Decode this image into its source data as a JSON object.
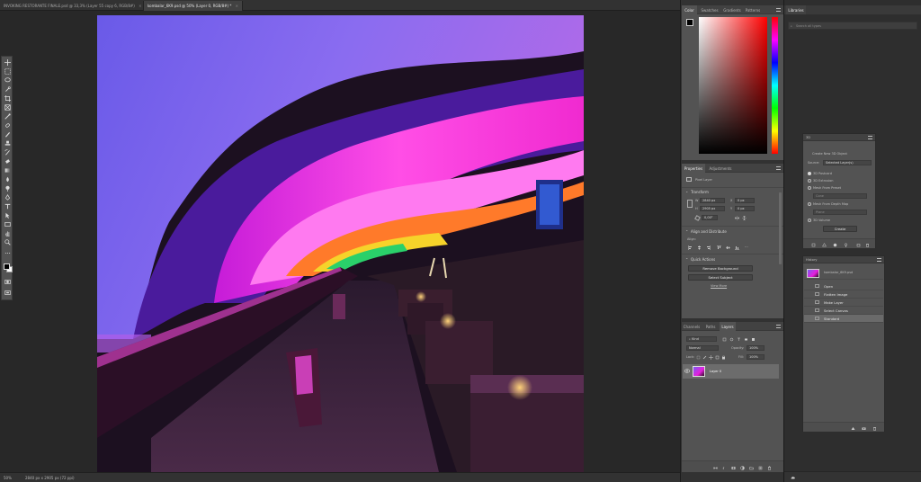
{
  "document_tabs": [
    {
      "label": "INVOKING RESTORANTE FINALE.psd @ 33,3% (Layer 55 copy 6, RGB/8#)",
      "close": "×"
    },
    {
      "label": "kombalar_6K9.psd @ 50% (Layer 0, RGB/8#) *",
      "close": "×"
    }
  ],
  "status": {
    "zoom": "50%",
    "doc_info": "2840 px x 2905 px (72 ppi)"
  },
  "color_panel": {
    "tabs": [
      "Color",
      "Swatches",
      "Gradients",
      "Patterns"
    ]
  },
  "properties_panel": {
    "tabs": [
      "Properties",
      "Adjustments"
    ],
    "layer_kind": "Pixel Layer",
    "transform": {
      "title": "Transform",
      "w_label": "W",
      "w_value": "2840 px",
      "h_label": "H",
      "h_value": "2905 px",
      "x_label": "X",
      "x_value": "0 px",
      "y_label": "Y",
      "y_value": "0 px",
      "angle": "0,00°"
    },
    "align": {
      "title": "Align and Distribute",
      "align_label": "Align:",
      "more": "..."
    },
    "quick_actions": {
      "title": "Quick Actions",
      "remove_bg": "Remove Background",
      "select_subject": "Select Subject",
      "view_more": "View More"
    }
  },
  "layers_panel": {
    "tabs": [
      "Channels",
      "Paths",
      "Layers"
    ],
    "filter_kind": "Kind",
    "blend_mode": "Normal",
    "opacity_label": "Opacity:",
    "opacity_value": "100%",
    "lock_label": "Lock:",
    "fill_label": "Fill:",
    "fill_value": "100%",
    "layer_name": "Layer 0"
  },
  "libraries": {
    "title": "Libraries",
    "search_placeholder": "Search all types"
  },
  "panel_3d": {
    "title": "3D",
    "create_label": "Create New 3D Object",
    "source_label": "Source:",
    "source_value": "Selected Layer(s)",
    "options": [
      "3D Postcard",
      "3D Extrusion",
      "Mesh From Preset",
      "Mesh From Depth Map",
      "3D Volume"
    ],
    "preset_value": "Cone",
    "depth_value": "Plane",
    "create_button": "Create"
  },
  "history": {
    "title": "History",
    "snapshot": "kombalar_6K9.psd",
    "items": [
      "Open",
      "Flatten Image",
      "Make Layer",
      "Select Canvas",
      "Standard"
    ]
  },
  "colors": {
    "accent_magenta": "#e61edc",
    "accent_purple": "#7a5cf0",
    "ui_dark": "#282828",
    "ui_panel": "#535353"
  }
}
